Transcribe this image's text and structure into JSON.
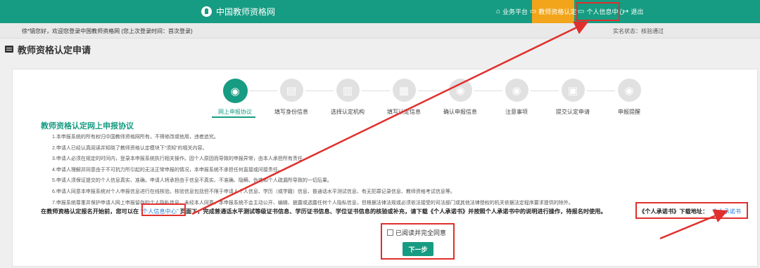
{
  "header": {
    "site_name": "中国教师资格网",
    "nav": {
      "platform": "业务平台",
      "cert": "教师资格认定",
      "personal": "个人信息中心",
      "logout": "退出"
    },
    "icons": {
      "logo": "teacher-hat-icon",
      "platform": "home-icon",
      "cert": "document-icon",
      "personal": "monitor-icon",
      "logout": "logout-icon"
    }
  },
  "welcome": {
    "text": "徐*镜您好，欢迎您登录中国教师资格网 (您上次登录时间：首次登录)",
    "status": "实名状态：核验通过"
  },
  "page": {
    "title": "教师资格认定申请"
  },
  "steps": [
    {
      "label": "网上申报协议",
      "icon": "eye-icon",
      "glyph": "◉"
    },
    {
      "label": "填写身份信息",
      "icon": "form-icon",
      "glyph": "▤"
    },
    {
      "label": "选择认定机构",
      "icon": "institution-icon",
      "glyph": "▥"
    },
    {
      "label": "填写认定信息",
      "icon": "clipboard-icon",
      "glyph": "▦"
    },
    {
      "label": "确认申报信息",
      "icon": "eye-icon",
      "glyph": "◉"
    },
    {
      "label": "注意事项",
      "icon": "eye-icon",
      "glyph": "◉"
    },
    {
      "label": "提交认定申请",
      "icon": "building-icon",
      "glyph": "▣"
    },
    {
      "label": "申报提醒",
      "icon": "eye-icon",
      "glyph": "◉"
    }
  ],
  "agreement": {
    "title": "教师资格认定网上申报协议",
    "terms": [
      "1.本申报系统的所有权归中国教师资格网所有，不得修改或他用，违者追究。",
      "2.申请人已经认真阅读并知晓了教师资格认定模块下“须知”的相关内容。",
      "3.申请人必须在规定的时间内，登录本申报系统执行相关操作。因个人原因而导致的申报异常，由本人承担所有责任。",
      "4.申请人理解并同意由于不可抗力所引起的无法正常申报的情况，本申报系统不承担任何直接或间接责任。",
      "5.申请人须保证提交的个人信息真实、准确。申请人将承担由于信息不真实、不准确、隐瞒、伪造和个人疏漏所导致的一切后果。",
      "6.申请人同意本申报系统对个人申报信息进行在线核验。核验信息包括但不限于申请人个人信息、学历（或学籍）信息、普通话水平测试信息、有无犯罪记录信息、教师资格考试信息等。",
      "7.申报系统尊重并保护申请人网上申报留存的个人隐私信息。未经本人同意，本申报系统不会主动公开、编辑、披露或透露任何个人隐私信息，但根据法律法规或必须依法接受的司法部门或其他法律授权的机关依据法定程序要求提供的除外。"
    ],
    "notice_before": "在教师资格认定报名开始前，您可以在",
    "notice_link": "“个人信息中心”",
    "notice_after": "页面下，完成普通话水平测试等级证书信息、学历证书信息、学位证书信息的核验或补充，请下载《个人承诺书》并按照个人承诺书中的说明进行操作，待报名时使用。",
    "download_label": "《个人承诺书》下载地址：",
    "download_link": "个人承诺书",
    "checkbox_label": "已阅读并完全同意",
    "next_button": "下一步"
  },
  "colors": {
    "primary": "#169c82",
    "cert_tab": "#f2a51a",
    "annotation": "#e0302d",
    "link": "#2a7fd6"
  }
}
